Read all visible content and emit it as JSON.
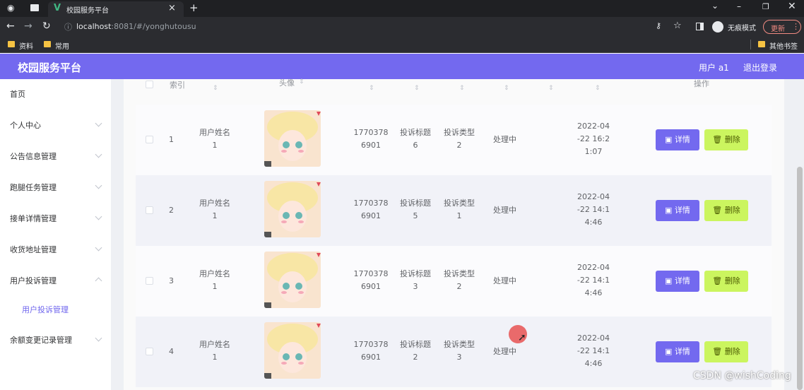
{
  "browser": {
    "tab_title": "校园服务平台",
    "url_host": "localhost",
    "url_rest": ":8081/#/yonghutousu",
    "incognito_label": "无痕模式",
    "update_label": "更新",
    "bookmarks": [
      "资料",
      "常用"
    ],
    "other_bookmarks": "其他书签"
  },
  "app": {
    "brand": "校园服务平台",
    "user_label": "用户 a1",
    "logout_label": "退出登录"
  },
  "sidebar": {
    "items": [
      "首页",
      "个人中心",
      "公告信息管理",
      "跑腿任务管理",
      "接单详情管理",
      "收货地址管理",
      "用户投诉管理"
    ],
    "sub_item": "用户投诉管理",
    "last_item": "余额变更记录管理"
  },
  "table": {
    "headers": {
      "index": "索引",
      "avatar": "头像",
      "ops": "操作"
    },
    "detail_label": "详情",
    "delete_label": "删除",
    "rows": [
      {
        "index": "1",
        "name_l1": "用户姓名",
        "name_l2": "1",
        "phone_l1": "1770378",
        "phone_l2": "6901",
        "title_l1": "投诉标题",
        "title_l2": "6",
        "type_l1": "投诉类型",
        "type_l2": "2",
        "status": "处理中",
        "time_l1": "2022-04",
        "time_l2": "-22 16:2",
        "time_l3": "1:07"
      },
      {
        "index": "2",
        "name_l1": "用户姓名",
        "name_l2": "1",
        "phone_l1": "1770378",
        "phone_l2": "6901",
        "title_l1": "投诉标题",
        "title_l2": "5",
        "type_l1": "投诉类型",
        "type_l2": "1",
        "status": "处理中",
        "time_l1": "2022-04",
        "time_l2": "-22 14:1",
        "time_l3": "4:46"
      },
      {
        "index": "3",
        "name_l1": "用户姓名",
        "name_l2": "1",
        "phone_l1": "1770378",
        "phone_l2": "6901",
        "title_l1": "投诉标题",
        "title_l2": "3",
        "type_l1": "投诉类型",
        "type_l2": "2",
        "status": "处理中",
        "time_l1": "2022-04",
        "time_l2": "-22 14:1",
        "time_l3": "4:46"
      },
      {
        "index": "4",
        "name_l1": "用户姓名",
        "name_l2": "1",
        "phone_l1": "1770378",
        "phone_l2": "6901",
        "title_l1": "投诉标题",
        "title_l2": "2",
        "type_l1": "投诉类型",
        "type_l2": "3",
        "status": "处理中",
        "time_l1": "2022-04",
        "time_l2": "-22 14:1",
        "time_l3": "4:46"
      }
    ]
  },
  "watermark": "CSDN @wishCoding",
  "colors": {
    "accent": "#7369ef",
    "delete_btn": "#cbf55f",
    "chrome_dark": "#2b2c30"
  }
}
